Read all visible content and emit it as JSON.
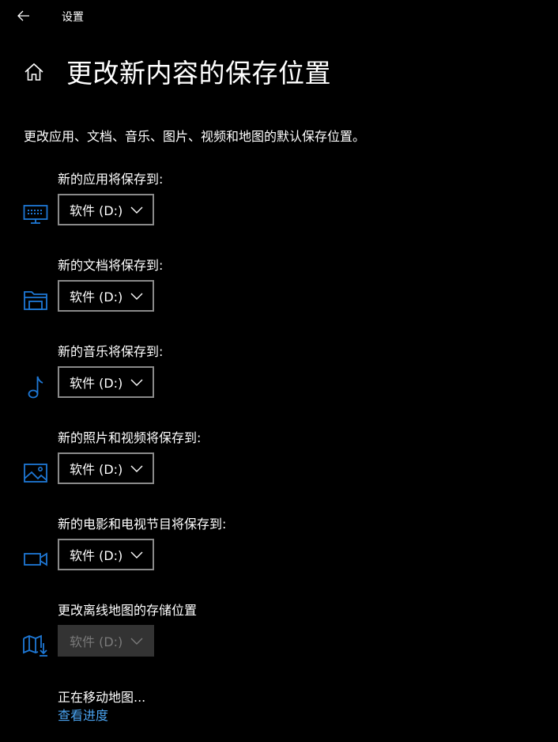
{
  "header": {
    "app_title": "设置",
    "page_title": "更改新内容的保存位置"
  },
  "description": "更改应用、文档、音乐、图片、视频和地图的默认保存位置。",
  "sections": [
    {
      "label": "新的应用将保存到:",
      "icon": "monitor-icon",
      "value": "软件 (D:)",
      "enabled": true
    },
    {
      "label": "新的文档将保存到:",
      "icon": "folder-icon",
      "value": "软件 (D:)",
      "enabled": true
    },
    {
      "label": "新的音乐将保存到:",
      "icon": "music-note-icon",
      "value": "软件 (D:)",
      "enabled": true
    },
    {
      "label": "新的照片和视频将保存到:",
      "icon": "picture-icon",
      "value": "软件 (D:)",
      "enabled": true
    },
    {
      "label": "新的电影和电视节目将保存到:",
      "icon": "video-camera-icon",
      "value": "软件 (D:)",
      "enabled": true
    },
    {
      "label": "更改离线地图的存储位置",
      "icon": "map-download-icon",
      "value": "软件 (D:)",
      "enabled": false
    }
  ],
  "status": {
    "moving_text": "正在移动地图...",
    "link_text": "查看进度"
  },
  "colors": {
    "background": "#000000",
    "accent": "#1e78d6",
    "link": "#4aa3f0",
    "dropdown_border": "#8a8a8a",
    "disabled_bg": "#333333"
  }
}
